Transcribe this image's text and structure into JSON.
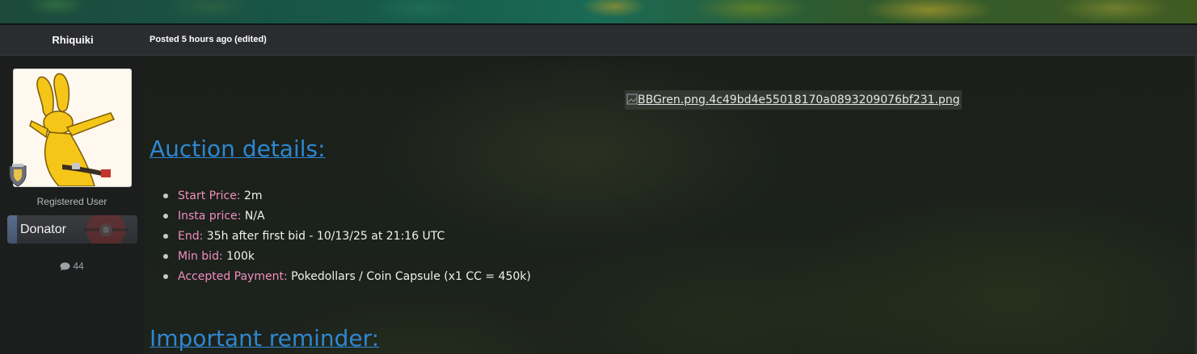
{
  "post": {
    "author": "Rhiquiki",
    "posted_meta": "Posted 5 hours ago (edited)",
    "user_title": "Registered User",
    "badge_label": "Donator",
    "post_count": "44",
    "embedded_image_alt": "BBGren.png.4c49bd4e55018170a0893209076bf231.png"
  },
  "content": {
    "heading_1": "Auction details:",
    "heading_2": "Important reminder:",
    "details": [
      {
        "key": "Start Price:",
        "value": "2m"
      },
      {
        "key": "Insta price:",
        "value": "N/A"
      },
      {
        "key": "End:",
        "value": "35h after first bid - 10/13/25 at 21:16 UTC"
      },
      {
        "key": "Min bid:",
        "value": "100k"
      },
      {
        "key": "Accepted Payment:",
        "value": "Pokedollars / Coin Capsule (x1 CC = 450k)"
      }
    ]
  },
  "icons": {
    "rank": "rank-shield-icon",
    "comment": "comment-icon",
    "pokeball": "pokeball-icon",
    "broken_image": "broken-image-icon"
  },
  "colors": {
    "heading": "#2e87d0",
    "detail_key": "#f28ec0",
    "detail_value": "#f3f3e8",
    "header_bar": "#2b2c2f"
  }
}
